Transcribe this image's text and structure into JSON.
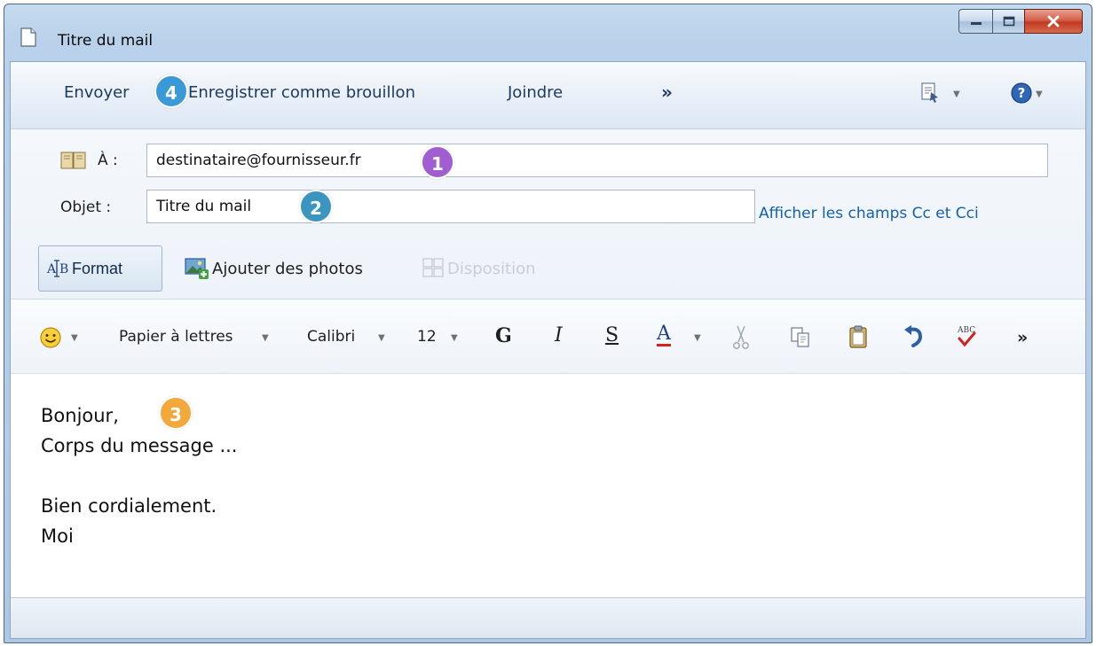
{
  "window": {
    "title": "Titre du mail",
    "buttons": [
      "minimize",
      "maximize",
      "close"
    ]
  },
  "toolbar": {
    "send_label": "Envoyer",
    "save_draft_label": "Enregistrer comme brouillon",
    "attach_label": "Joindre",
    "more_label": "»",
    "priority_icon": "message-options-icon",
    "help_icon": "help-icon"
  },
  "fields": {
    "to_label": "À :",
    "to_value": "destinataire@fournisseur.fr",
    "subject_label": "Objet :",
    "subject_value": "Titre du mail",
    "show_cc_bcc_label": "Afficher les champs Cc et Cci"
  },
  "compose_tools": {
    "format_label": "Format",
    "add_photos_label": "Ajouter des photos",
    "layout_label": "Disposition"
  },
  "formatting": {
    "emoji_icon": "emoticon-icon",
    "stationery_label": "Papier à lettres",
    "font_family": "Calibri",
    "font_size": "12",
    "bold_label": "G",
    "italic_label": "I",
    "underline_label": "S",
    "font_color_label": "A",
    "more_label": "»"
  },
  "body": {
    "lines": [
      "Bonjour,",
      "Corps du message ...",
      "",
      "Bien cordialement.",
      "Moi"
    ]
  },
  "badges": {
    "one": "1",
    "two": "2",
    "three": "3",
    "four": "4"
  },
  "colors": {
    "badge_one": "#a05ed0",
    "badge_two": "#3a95bf",
    "badge_three": "#f2a83a",
    "badge_four": "#3a9ad8",
    "link": "#1660a8",
    "close_button": "#c23a22"
  }
}
